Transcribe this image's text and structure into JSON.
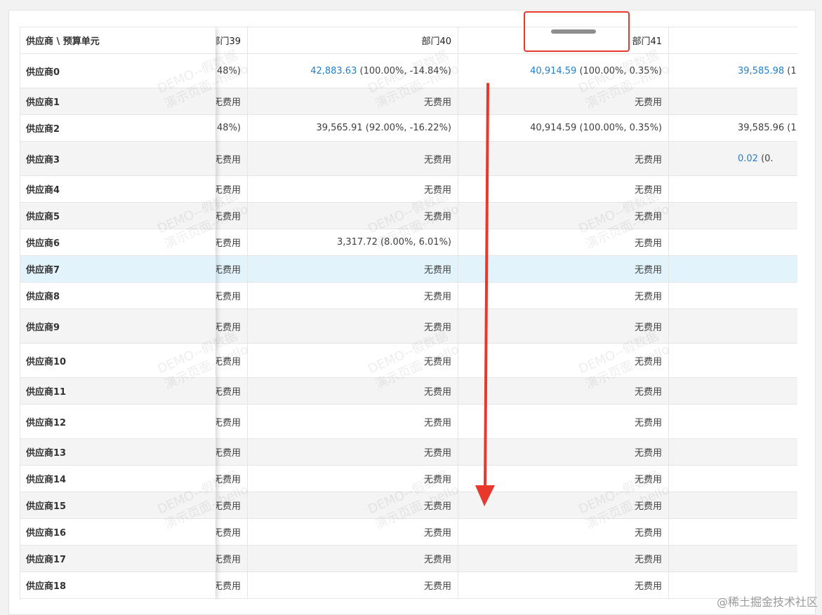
{
  "table": {
    "corner_header": "供应商 \\ 预算单元",
    "columns": {
      "c39": "部门39",
      "c40": "部门40",
      "c41": "部门41",
      "c42": ""
    },
    "rows": [
      {
        "supplier": "供应商0",
        "c39": "48%)",
        "c40_link": "42,883.63",
        "c40_pct": " (100.00%, -14.84%)",
        "c41_link": "40,914.59",
        "c41_pct": " (100.00%, 0.35%)",
        "c42_link": "39,585.98",
        "c42_pct": " (1"
      },
      {
        "supplier": "供应商1",
        "c39": "无费用",
        "c40": "无费用",
        "c41": "无费用",
        "c42": ""
      },
      {
        "supplier": "供应商2",
        "c39": "48%)",
        "c40": "39,565.91 (92.00%, -16.22%)",
        "c41": "40,914.59 (100.00%, 0.35%)",
        "c42": "39,585.96 (1"
      },
      {
        "supplier": "供应商3",
        "c39": "无费用",
        "c40": "无费用",
        "c41": "无费用",
        "c42_link": "0.02",
        "c42_pct": " (0."
      },
      {
        "supplier": "供应商4",
        "c39": "无费用",
        "c40": "无费用",
        "c41": "无费用",
        "c42": ""
      },
      {
        "supplier": "供应商5",
        "c39": "无费用",
        "c40": "无费用",
        "c41": "无费用",
        "c42": ""
      },
      {
        "supplier": "供应商6",
        "c39": "无费用",
        "c40": "3,317.72 (8.00%, 6.01%)",
        "c41": "无费用",
        "c42": ""
      },
      {
        "supplier": "供应商7",
        "c39": "无费用",
        "c40": "无费用",
        "c41": "无费用",
        "c42": ""
      },
      {
        "supplier": "供应商8",
        "c39": "无费用",
        "c40": "无费用",
        "c41": "无费用",
        "c42": ""
      },
      {
        "supplier": "供应商9",
        "c39": "无费用",
        "c40": "无费用",
        "c41": "无费用",
        "c42": ""
      },
      {
        "supplier": "供应商10",
        "c39": "无费用",
        "c40": "无费用",
        "c41": "无费用",
        "c42": ""
      },
      {
        "supplier": "供应商11",
        "c39": "无费用",
        "c40": "无费用",
        "c41": "无费用",
        "c42": ""
      },
      {
        "supplier": "供应商12",
        "c39": "无费用",
        "c40": "无费用",
        "c41": "无费用",
        "c42": ""
      },
      {
        "supplier": "供应商13",
        "c39": "无费用",
        "c40": "无费用",
        "c41": "无费用",
        "c42": ""
      },
      {
        "supplier": "供应商14",
        "c39": "无费用",
        "c40": "无费用",
        "c41": "无费用",
        "c42": ""
      },
      {
        "supplier": "供应商15",
        "c39": "无费用",
        "c40": "无费用",
        "c41": "无费用",
        "c42": ""
      },
      {
        "supplier": "供应商16",
        "c39": "无费用",
        "c40": "无费用",
        "c41": "无费用",
        "c42": ""
      },
      {
        "supplier": "供应商17",
        "c39": "无费用",
        "c40": "无费用",
        "c41": "无费用",
        "c42": ""
      },
      {
        "supplier": "供应商18",
        "c39": "无费用",
        "c40": "无费用",
        "c41": "无费用",
        "c42": ""
      }
    ]
  },
  "watermark": {
    "line1": "DEMO--假数据",
    "line2": "演示页面--hello"
  },
  "credit": "@稀土掘金技术社区",
  "colors": {
    "link": "#1f7fd0",
    "row_hover": "#e3f3fb",
    "row_stripe": "#f4f4f4",
    "annotation_red": "#e8382c"
  }
}
